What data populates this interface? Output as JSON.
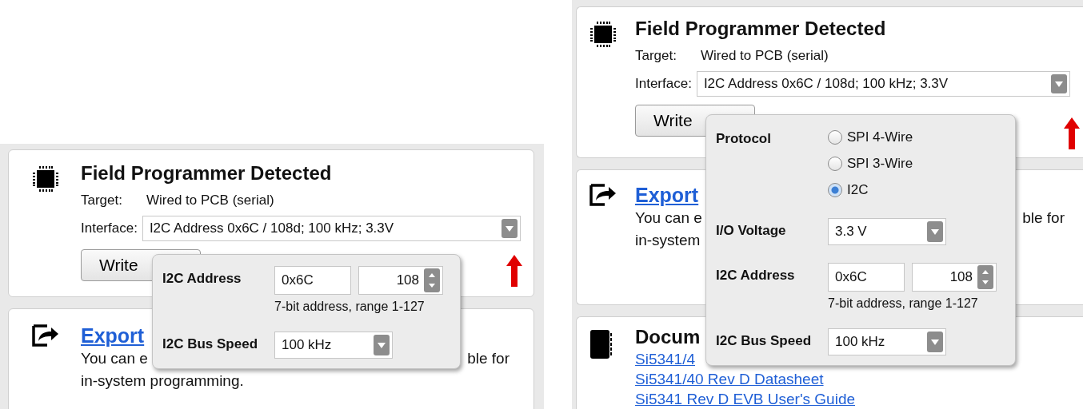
{
  "panels": [
    {
      "programmer": {
        "title": "Field Programmer Detected",
        "target_label": "Target:",
        "target_value": "Wired to PCB (serial)",
        "interface_label": "Interface:",
        "interface_value": "I2C Address 0x6C / 108d; 100 kHz; 3.3V",
        "write_button": "Write"
      },
      "export": {
        "link": "Export",
        "line_1_start": "You can e",
        "line_1_end": "ble for",
        "line_2": "in-system programming."
      },
      "popup": {
        "fields": [
          {
            "kind": "address",
            "label": "I2C Address",
            "hex": "0x6C",
            "decimal": "108",
            "hint": "7-bit address, range 1-127"
          },
          {
            "kind": "select",
            "label": "I2C Bus Speed",
            "value": "100 kHz"
          }
        ]
      }
    },
    {
      "programmer": {
        "title": "Field Programmer Detected",
        "target_label": "Target:",
        "target_value": "Wired to PCB (serial)",
        "interface_label": "Interface:",
        "interface_value": "I2C Address 0x6C / 108d; 100 kHz; 3.3V",
        "write_button": "Write"
      },
      "export": {
        "link": "Export",
        "line_1_start": "You can e",
        "line_1_end": "ble for",
        "line_2": "in-system"
      },
      "documentation": {
        "title": "Docum",
        "links": [
          "Si5341/4",
          "Si5341/40 Rev D Datasheet",
          "Si5341 Rev D EVB User's Guide"
        ]
      },
      "popup": {
        "fields": [
          {
            "kind": "radio",
            "label": "Protocol",
            "options": [
              {
                "label": "SPI 4-Wire",
                "selected": false
              },
              {
                "label": "SPI 3-Wire",
                "selected": false
              },
              {
                "label": "I2C",
                "selected": true
              }
            ]
          },
          {
            "kind": "select",
            "label": "I/O Voltage",
            "value": "3.3 V"
          },
          {
            "kind": "address",
            "label": "I2C Address",
            "hex": "0x6C",
            "decimal": "108",
            "hint": "7-bit address, range 1-127"
          },
          {
            "kind": "select",
            "label": "I2C Bus Speed",
            "value": "100 kHz"
          }
        ]
      }
    }
  ]
}
